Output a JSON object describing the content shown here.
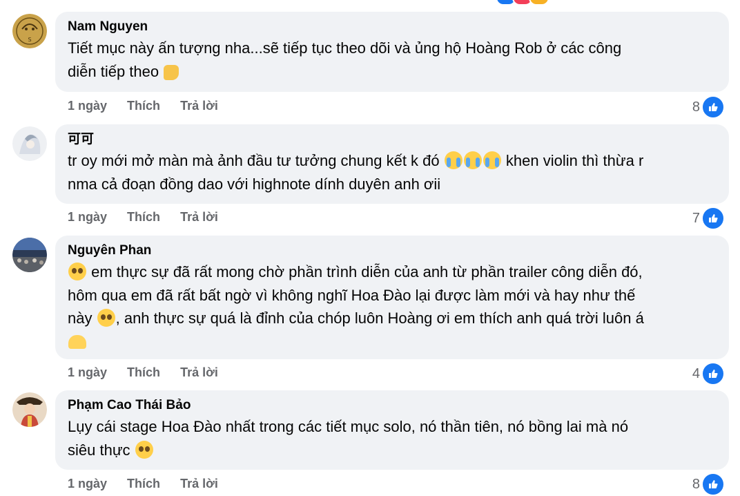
{
  "colors": {
    "bubble": "#f0f2f5",
    "accent": "#1877f2",
    "meta": "#65676b"
  },
  "comments": [
    {
      "author": "Nam Nguyen",
      "text_lines": [
        "Tiết mục này ấn tượng nha...sẽ tiếp tục theo dõi và ủng hộ Hoàng Rob ở các công",
        "diễn tiếp theo"
      ],
      "emoji": "thumbs-up",
      "time": "1 ngày",
      "like": "Thích",
      "reply": "Trả lời",
      "likes": "8"
    },
    {
      "author": "可可",
      "text_lines": [
        "tr oy mới mở màn mà ảnh đầu tư tưởng chung kết k đó",
        "khen violin thì thừa r",
        "nma cả đoạn đồng dao với highnote dính duyên anh ơii"
      ],
      "emoji": "crying-face x3",
      "time": "1 ngày",
      "like": "Thích",
      "reply": "Trả lời",
      "likes": "7"
    },
    {
      "author": "Nguyên Phan",
      "text_lines": [
        "em thực sự đã rất mong chờ phần trình diễn của anh từ phần trailer công diễn đó,",
        "hôm qua em đã rất bất ngờ vì không nghĩ Hoa Đào lại được làm mới và hay như thế",
        "này",
        ", anh thực sự quá là đỉnh của chóp luôn Hoàng ơi em thích anh quá trời luôn á"
      ],
      "emoji": "pleading-face, heart-hands",
      "time": "1 ngày",
      "like": "Thích",
      "reply": "Trả lời",
      "likes": "4"
    },
    {
      "author": "Phạm Cao Thái Bảo",
      "text_lines": [
        "Lụy cái stage Hoa Đào nhất trong các tiết mục solo, nó thần tiên, nó bồng lai mà nó",
        "siêu thực"
      ],
      "emoji": "pleading-face",
      "time": "1 ngày",
      "like": "Thích",
      "reply": "Trả lời",
      "likes": "8"
    }
  ]
}
